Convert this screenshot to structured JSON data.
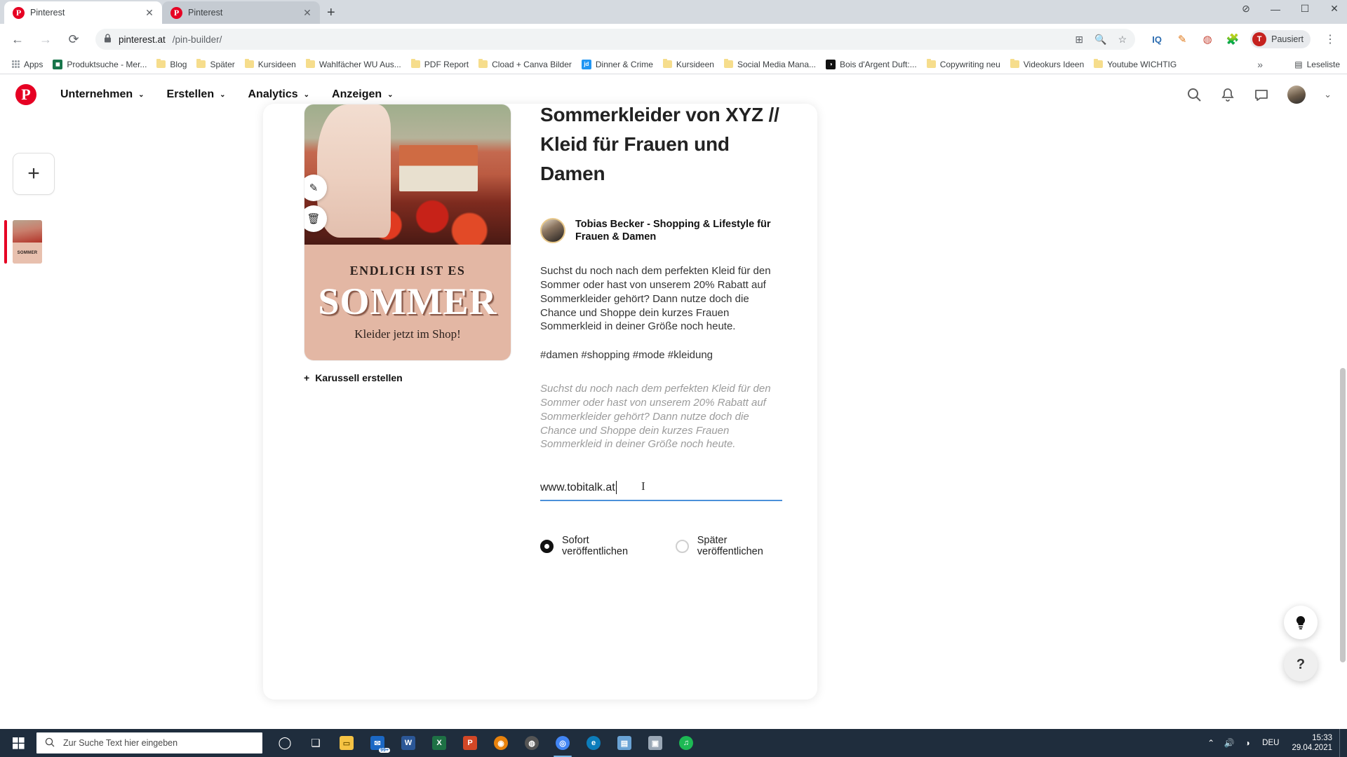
{
  "browser": {
    "tabs": [
      {
        "title": "Pinterest",
        "active": true
      },
      {
        "title": "Pinterest",
        "active": false
      }
    ],
    "newtab_label": "+",
    "window_controls": {
      "minimize": "—",
      "maximize": "☐",
      "close": "✕",
      "extension": "⊘"
    },
    "nav": {
      "back": "←",
      "forward": "→",
      "reload": "⟳"
    },
    "address": {
      "lock": "🔒",
      "domain": "pinterest.at",
      "path": "/pin-builder/"
    },
    "omni_icons": [
      "install-icon",
      "zoom-icon",
      "star-icon"
    ],
    "toolbar_icons": [
      "iq-extension",
      "wrench-extension",
      "shield-extension",
      "puzzle-extension"
    ],
    "profile": {
      "initial": "T",
      "label": "Pausiert"
    },
    "menu_icon": "⋮",
    "bookmarks": [
      {
        "label": "Apps",
        "icon": "apps-grid"
      },
      {
        "label": "Produktsuche - Mer...",
        "icon": "site-green"
      },
      {
        "label": "Blog",
        "icon": "folder"
      },
      {
        "label": "Später",
        "icon": "folder"
      },
      {
        "label": "Kursideen",
        "icon": "folder"
      },
      {
        "label": "Wahlfächer WU Aus...",
        "icon": "folder"
      },
      {
        "label": "PDF Report",
        "icon": "folder"
      },
      {
        "label": "Cload + Canva Bilder",
        "icon": "folder"
      },
      {
        "label": "Dinner & Crime",
        "icon": "site-blue",
        "icon_text": "jd"
      },
      {
        "label": "Kursideen",
        "icon": "folder"
      },
      {
        "label": "Social Media Mana...",
        "icon": "folder"
      },
      {
        "label": "Bois d'Argent Duft:...",
        "icon": "site-black",
        "icon_text": "◑"
      },
      {
        "label": "Copywriting neu",
        "icon": "folder"
      },
      {
        "label": "Videokurs Ideen",
        "icon": "folder"
      },
      {
        "label": "Youtube WICHTIG",
        "icon": "folder"
      }
    ],
    "bookmarks_overflow": "»",
    "reading_list": "Leseliste"
  },
  "pinterest": {
    "logo": "P",
    "nav": [
      {
        "label": "Unternehmen",
        "caret": "⌄"
      },
      {
        "label": "Erstellen",
        "caret": "⌄"
      },
      {
        "label": "Analytics",
        "caret": "⌄"
      },
      {
        "label": "Anzeigen",
        "caret": "⌄"
      }
    ],
    "header_icons": [
      "search-icon",
      "bell-icon",
      "message-icon",
      "avatar",
      "chevron-down-icon"
    ]
  },
  "builder": {
    "add_button": "+",
    "thumbnail_caption": "SOMMER",
    "image_tools": [
      {
        "name": "edit-pencil",
        "glyph": "✎"
      },
      {
        "name": "delete-trash",
        "glyph": "🗑"
      }
    ],
    "pin_image": {
      "line1": "ENDLICH IST ES",
      "line2": "SOMMER",
      "line3": "Kleider jetzt im Shop!"
    },
    "carousel_link": {
      "plus": "+",
      "label": "Karussell erstellen"
    },
    "title": "Sommerkleider von XYZ // Kleid für Frauen und Damen",
    "author": "Tobias Becker - Shopping & Lifestyle für Frauen & Damen",
    "description": "Suchst du noch nach dem perfekten Kleid für den Sommer oder hast von unserem 20% Rabatt auf Sommerkleider gehört? Dann nutze doch die Chance und Shoppe dein kurzes Frauen Sommerkleid in deiner Größe noch heute.",
    "tags": "#damen #shopping #mode #kleidung",
    "placeholder_hint": "Suchst du noch nach dem perfekten Kleid für den Sommer oder hast von unserem 20% Rabatt auf Sommerkleider gehört? Dann nutze doch die Chance und Shoppe dein kurzes Frauen Sommerkleid in deiner Größe noch heute.",
    "url_value": "www.tobitalk.at",
    "publish_options": [
      {
        "label": "Sofort veröffentlichen",
        "selected": true
      },
      {
        "label": "Später veröffentlichen",
        "selected": false
      }
    ],
    "fabs": [
      {
        "name": "idea-bulb-fab",
        "glyph": "💡"
      },
      {
        "name": "help-fab",
        "glyph": "?"
      }
    ]
  },
  "taskbar": {
    "start": "windows-start",
    "search_placeholder": "Zur Suche Text hier eingeben",
    "search_icon": "search-icon",
    "items": [
      {
        "name": "cortana-icon",
        "glyph": "◯",
        "color": "transparent"
      },
      {
        "name": "task-view-icon",
        "glyph": "❏",
        "color": "transparent"
      },
      {
        "name": "file-explorer-icon",
        "glyph": "📁",
        "color": "#f6c344"
      },
      {
        "name": "mail-icon",
        "glyph": "✉",
        "color": "#1b68c4",
        "badge": "99+"
      },
      {
        "name": "word-icon",
        "glyph": "W",
        "color": "#2b5797"
      },
      {
        "name": "excel-icon",
        "glyph": "X",
        "color": "#1e7145"
      },
      {
        "name": "powerpoint-icon",
        "glyph": "P",
        "color": "#d24726"
      },
      {
        "name": "firefox-icon",
        "glyph": "◉",
        "color": "#e8820c"
      },
      {
        "name": "disc-icon",
        "glyph": "◍",
        "color": "#555555"
      },
      {
        "name": "chrome-icon",
        "glyph": "◎",
        "color": "#4285f4",
        "active": true
      },
      {
        "name": "edge-icon",
        "glyph": "ⓔ",
        "color": "#0c7dbb"
      },
      {
        "name": "paint-icon",
        "glyph": "▤",
        "color": "#6aa3d5"
      },
      {
        "name": "photos-icon",
        "glyph": "🖼",
        "color": "#9aa7b5"
      },
      {
        "name": "spotify-icon",
        "glyph": "♫",
        "color": "#1db954"
      }
    ],
    "tray": {
      "chevron": "⌃",
      "volume": "🔊",
      "network": "◑",
      "language": "DEU",
      "time": "15:33",
      "date": "29.04.2021"
    }
  },
  "colors": {
    "pinterest_red": "#e60023",
    "focus_blue": "#4a90d9",
    "taskbar": "#1f2d3d",
    "tabstrip": "#d5dae0"
  }
}
